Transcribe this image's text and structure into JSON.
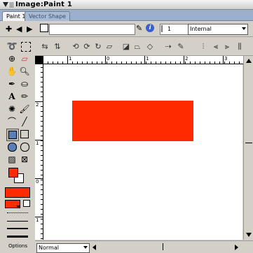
{
  "window": {
    "title": "Image:Paint 1"
  },
  "tabs": [
    {
      "label": "Paint 1",
      "active": true
    },
    {
      "label": "Vector Shape",
      "active": false
    }
  ],
  "toolbar": {
    "frame_number": "1",
    "render_mode": "Internal"
  },
  "ruler": {
    "top_labels": [
      "1",
      "0",
      "1",
      "2",
      "3"
    ],
    "left_labels": [
      "2",
      "1",
      "0",
      "1",
      "2"
    ]
  },
  "canvas": {
    "shape_color": "#ff2a00"
  },
  "tools_panel": {
    "fill_color": "#ff2a00",
    "options_label": "Options"
  },
  "status": {
    "ink_mode": "Normal"
  }
}
